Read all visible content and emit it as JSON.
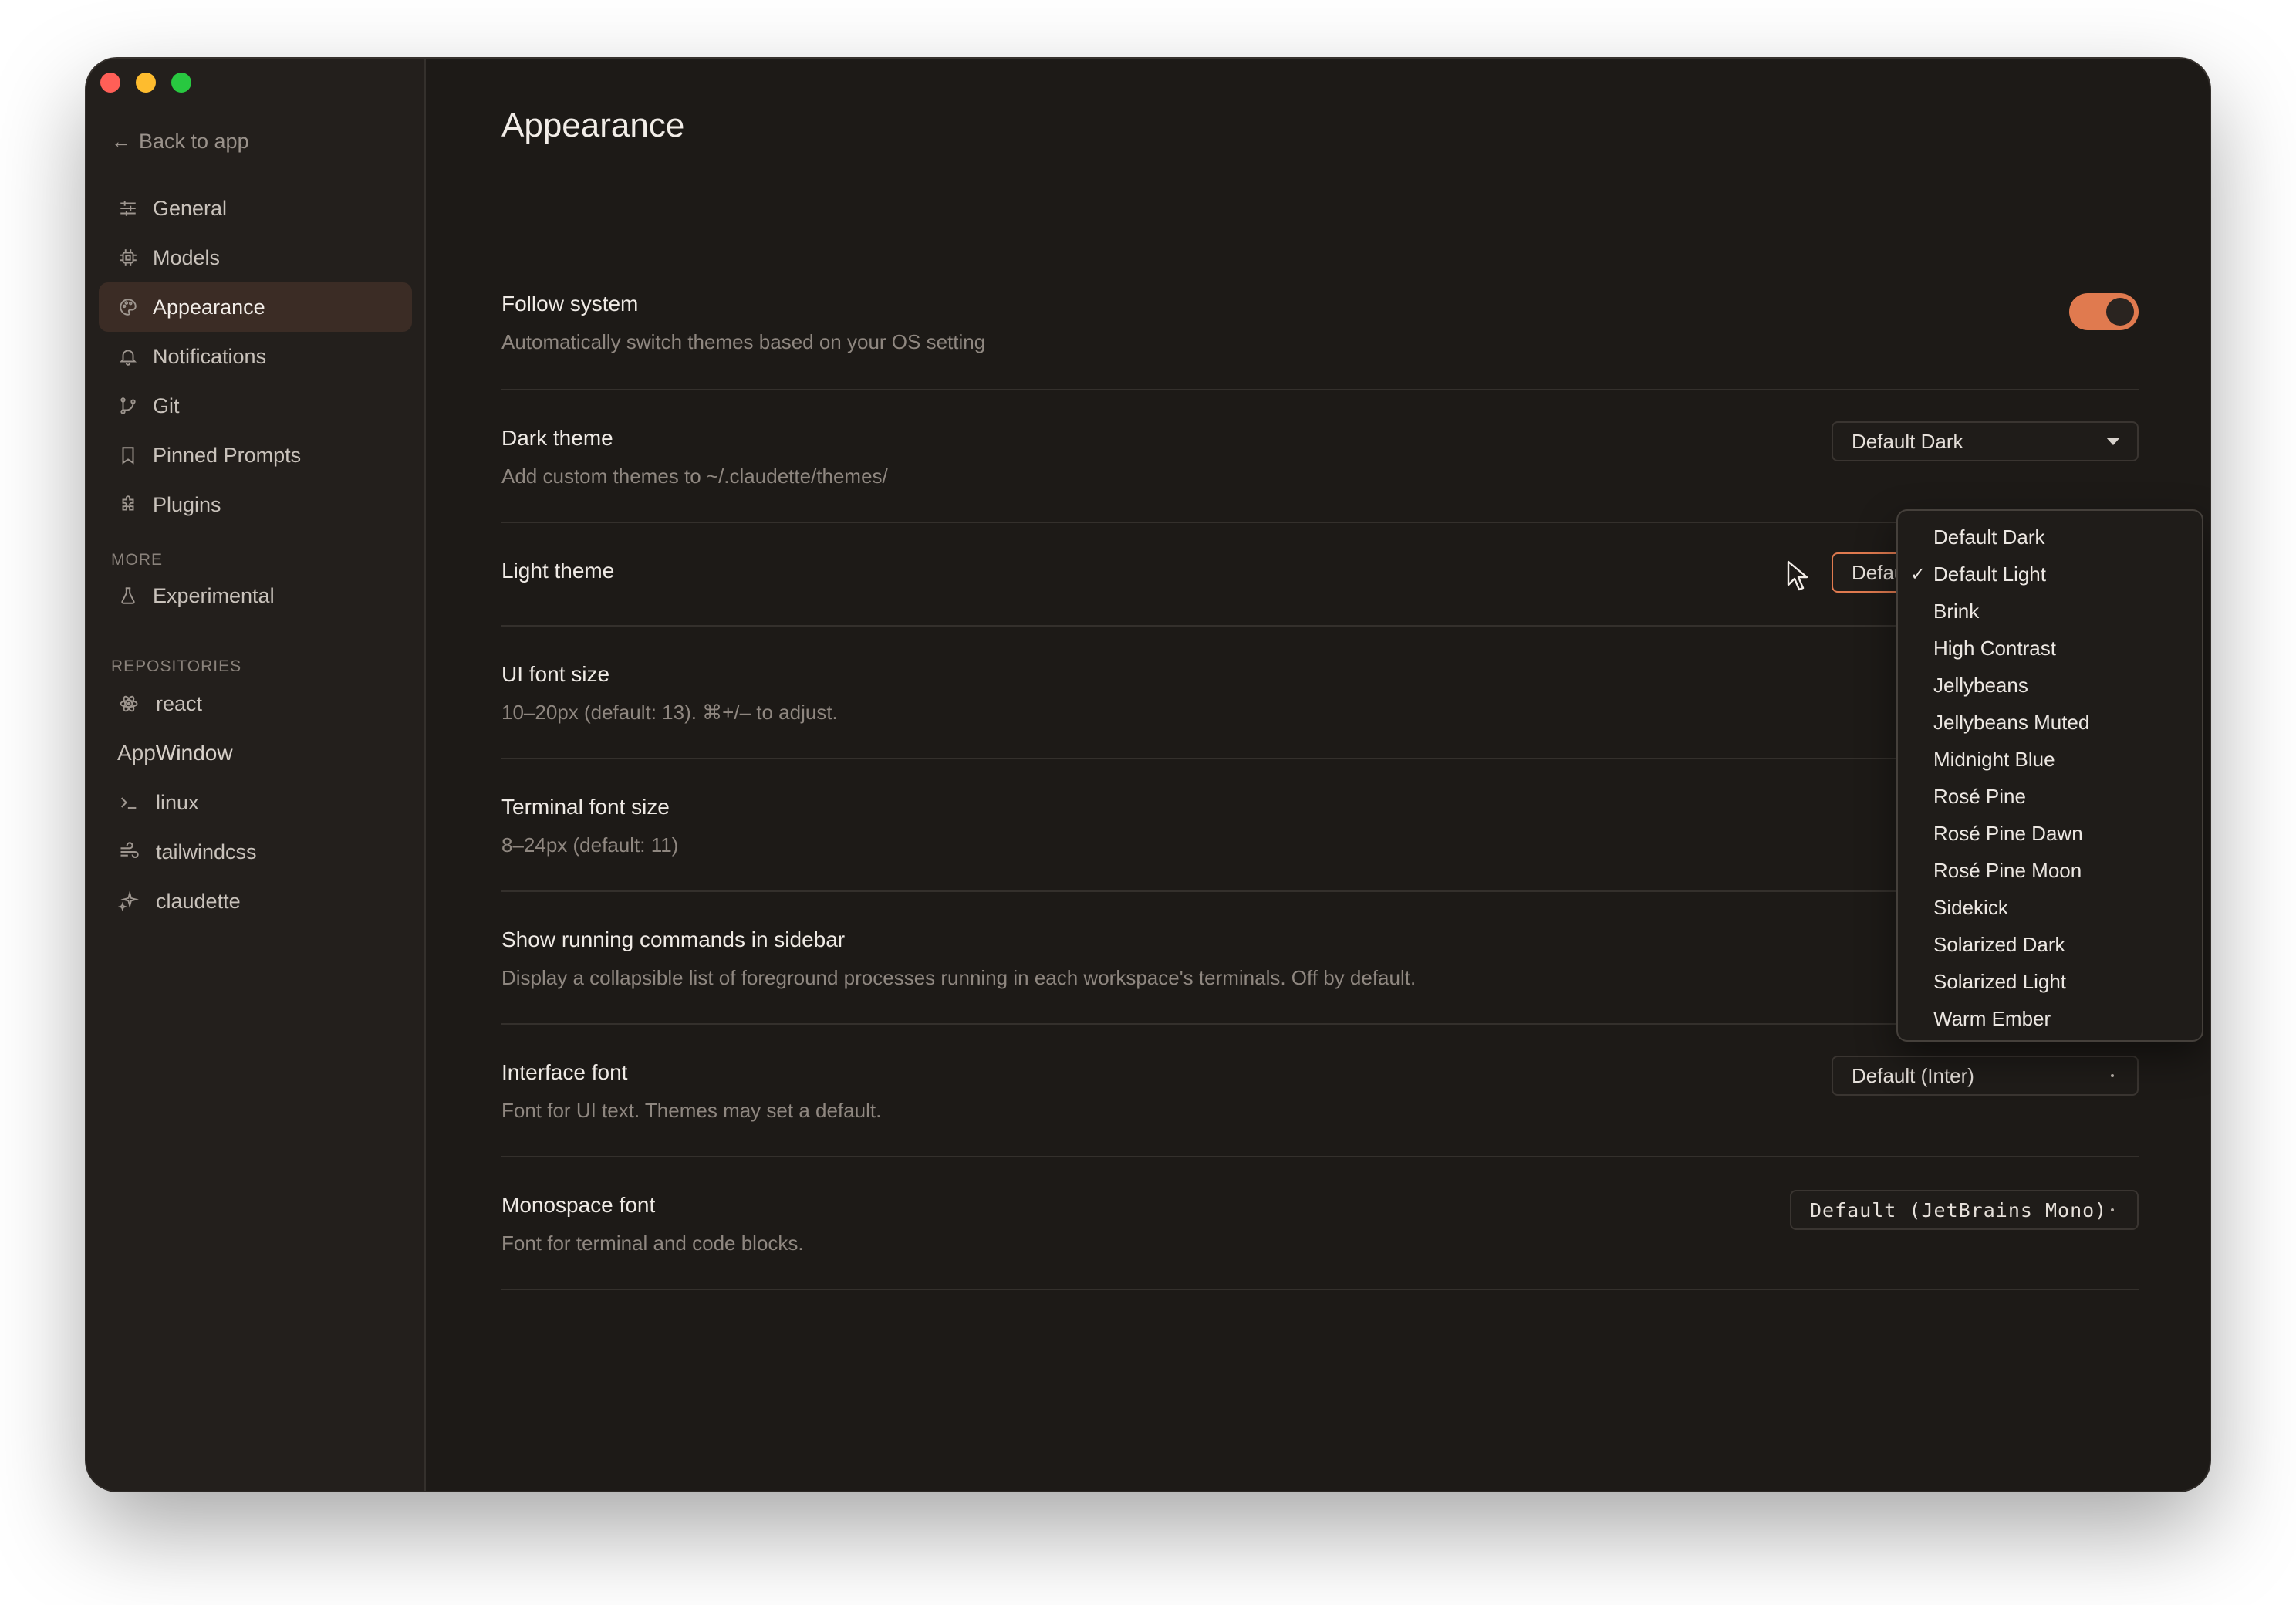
{
  "window": {
    "traffic_lights": [
      "close",
      "minimize",
      "maximize"
    ]
  },
  "sidebar": {
    "back_label": "Back to app",
    "items": [
      {
        "label": "General",
        "icon": "sliders-icon"
      },
      {
        "label": "Models",
        "icon": "chip-icon"
      },
      {
        "label": "Appearance",
        "icon": "palette-icon",
        "active": true
      },
      {
        "label": "Notifications",
        "icon": "bell-icon"
      },
      {
        "label": "Git",
        "icon": "git-branch-icon"
      },
      {
        "label": "Pinned Prompts",
        "icon": "bookmark-icon"
      },
      {
        "label": "Plugins",
        "icon": "puzzle-icon"
      }
    ],
    "more_label": "MORE",
    "more_items": [
      {
        "label": "Experimental",
        "icon": "flask-icon"
      }
    ],
    "repos_label": "REPOSITORIES",
    "repos": [
      {
        "label": "react",
        "icon": "atom-icon"
      },
      {
        "label_a": "App",
        "label_b": "Window",
        "overlap_a": "AppWin",
        "overlap_b": "Window"
      },
      {
        "label": "linux",
        "icon": "terminal-icon"
      },
      {
        "label": "tailwindcss",
        "icon": "wind-icon"
      },
      {
        "label": "claudette",
        "icon": "sparkle-icon"
      }
    ]
  },
  "main": {
    "title": "Appearance",
    "settings": {
      "follow_system": {
        "label": "Follow system",
        "desc": "Automatically switch themes based on your OS setting",
        "enabled": true
      },
      "dark_theme": {
        "label": "Dark theme",
        "desc": "Add custom themes to ~/.claudette/themes/",
        "value": "Default Dark"
      },
      "light_theme": {
        "label": "Light theme",
        "value": "Default Light"
      },
      "ui_font_size": {
        "label": "UI font size",
        "desc": "10–20px (default: 13). ⌘+/– to adjust."
      },
      "terminal_font_size": {
        "label": "Terminal font size",
        "desc": "8–24px (default: 11)"
      },
      "show_running": {
        "label": "Show running commands in sidebar",
        "desc": "Display a collapsible list of foreground processes running in each workspace's terminals. Off by default."
      },
      "interface_font": {
        "label": "Interface font",
        "desc": "Font for UI text. Themes may set a default.",
        "value": "Default (Inter)"
      },
      "monospace_font": {
        "label": "Monospace font",
        "desc": "Font for terminal and code blocks.",
        "value": "Default (JetBrains Mono)"
      }
    }
  },
  "dropdown": {
    "selected": "Default Light",
    "check_glyph": "✓",
    "options": [
      "Default Dark",
      "Default Light",
      "Brink",
      "High Contrast",
      "Jellybeans",
      "Jellybeans Muted",
      "Midnight Blue",
      "Rosé Pine",
      "Rosé Pine Dawn",
      "Rosé Pine Moon",
      "Sidekick",
      "Solarized Dark",
      "Solarized Light",
      "Warm Ember"
    ]
  },
  "colors": {
    "accent": "#e07a4f",
    "background": "#1d1a17",
    "sidebar": "#231f1c",
    "active_item": "#3b2c25"
  }
}
